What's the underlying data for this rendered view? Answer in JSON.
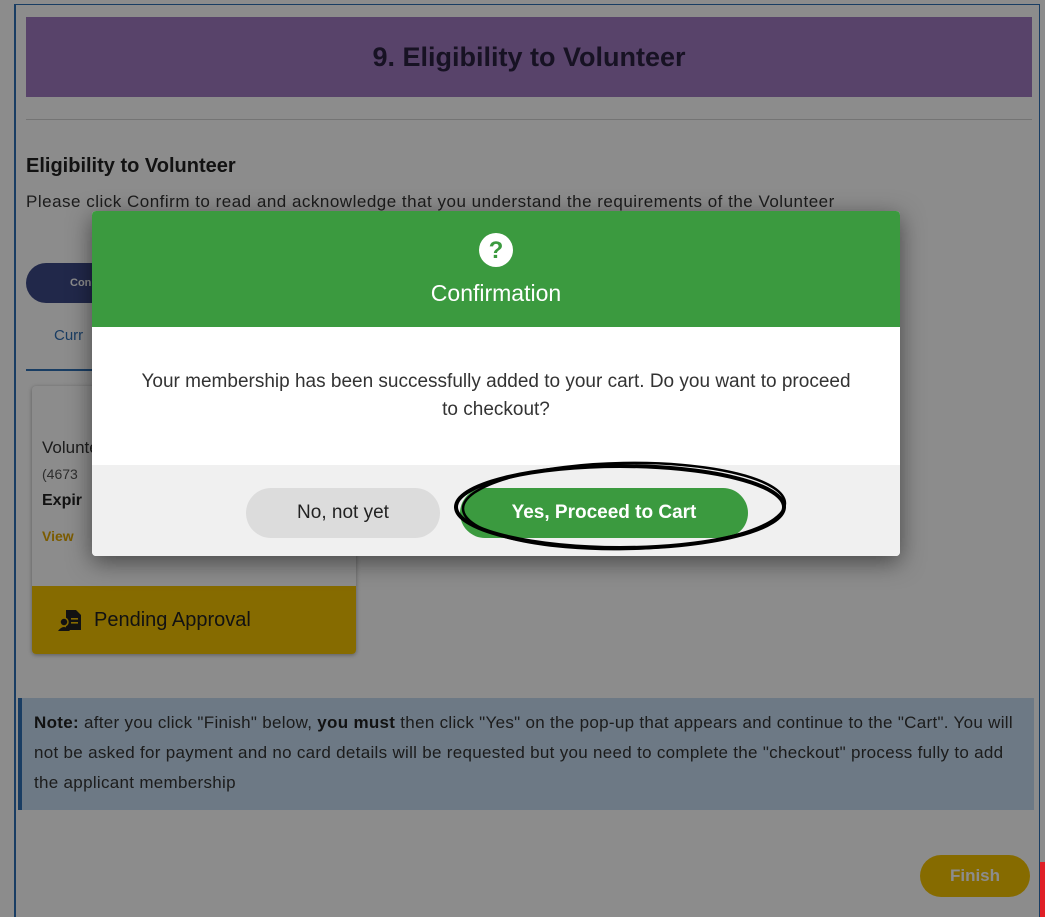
{
  "page": {
    "header_title": "9. Eligibility to Volunteer",
    "section_title": "Eligibility to Volunteer",
    "section_desc": "Please click Confirm to read and acknowledge that you understand the requirements of the Volunteer",
    "confirm_button": "Con",
    "tab_current": "Curr"
  },
  "card": {
    "name": "Volunteer",
    "id": "(4673",
    "expiry": "Expir",
    "view_link": "View",
    "status": "Pending Approval",
    "status_icon": "document-person-icon"
  },
  "note": {
    "prefix": "Note:",
    "text1": " after you click \"Finish\" below, ",
    "strong": "you must",
    "text2": " then click \"Yes\" on the pop-up that appears and continue to the \"Cart\". You will not be asked for payment and no card details will be requested but you need to complete the \"checkout\" process fully to add the applicant membership"
  },
  "finish_button": "Finish",
  "modal": {
    "icon": "question-icon",
    "title": "Confirmation",
    "message": "Your membership has been successfully added to your cart. Do you want to proceed to checkout?",
    "no_button": "No, not yet",
    "yes_button": "Yes, Proceed to Cart"
  },
  "colors": {
    "header_bg": "#a07bc1",
    "modal_green": "#3b9a3f",
    "pending_yellow": "#f5c400",
    "note_bg": "#c6ddf2",
    "annotation_black": "#000000"
  }
}
